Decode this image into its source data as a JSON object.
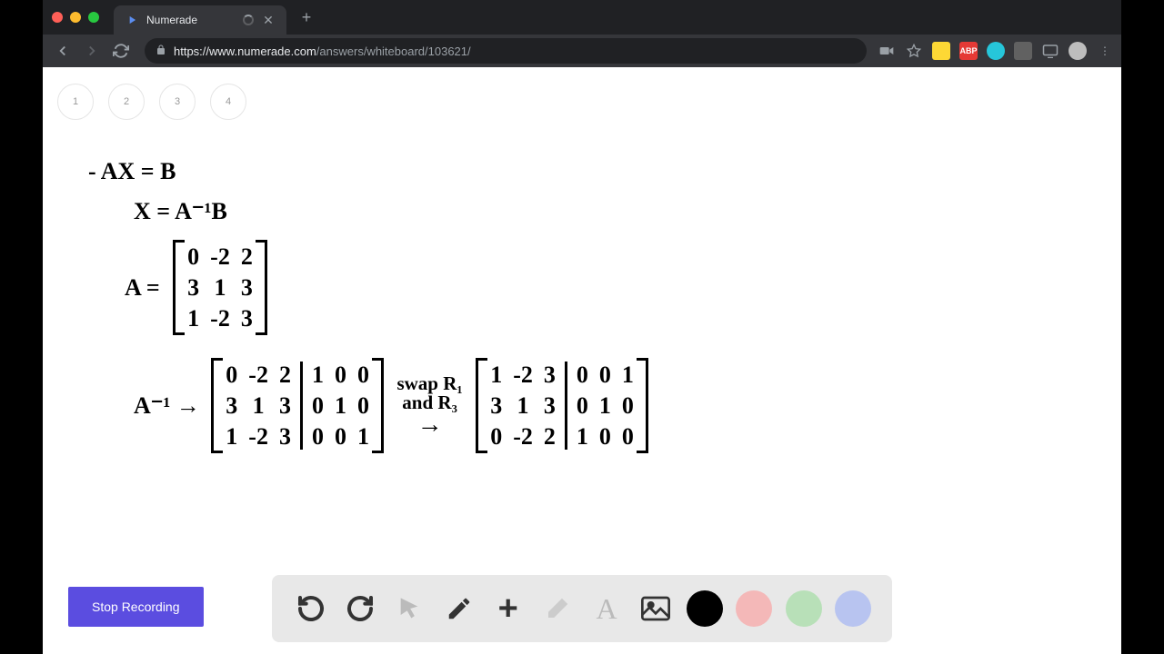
{
  "browser": {
    "tab_title": "Numerade",
    "url_host": "https://www.numerade.com",
    "url_path": "/answers/whiteboard/103621/"
  },
  "pages": [
    "1",
    "2",
    "3",
    "4"
  ],
  "math": {
    "eq1": "- AX = B",
    "eq2": "X = A⁻¹B",
    "a_label": "A =",
    "a_matrix": {
      "c1": [
        "0",
        "3",
        "1"
      ],
      "c2": [
        "-2",
        "1",
        "-2"
      ],
      "c3": [
        "2",
        "3",
        "3"
      ]
    },
    "ainv_label": "A⁻¹ →",
    "aug1": {
      "c1": [
        "0",
        "3",
        "1"
      ],
      "c2": [
        "-2",
        "1",
        "-2"
      ],
      "c3": [
        "2",
        "3",
        "3"
      ],
      "c4": [
        "1",
        "0",
        "0"
      ],
      "c5": [
        "0",
        "1",
        "0"
      ],
      "c6": [
        "0",
        "0",
        "1"
      ]
    },
    "step_note_1": "swap R₁",
    "step_note_2": "and R₃",
    "arrow2": "→",
    "aug2": {
      "c1": [
        "1",
        "3",
        "0"
      ],
      "c2": [
        "-2",
        "1",
        "-2"
      ],
      "c3": [
        "3",
        "3",
        "2"
      ],
      "c4": [
        "0",
        "0",
        "1"
      ],
      "c5": [
        "0",
        "1",
        "0"
      ],
      "c6": [
        "1",
        "0",
        "0"
      ]
    }
  },
  "controls": {
    "stop_recording": "Stop Recording"
  }
}
